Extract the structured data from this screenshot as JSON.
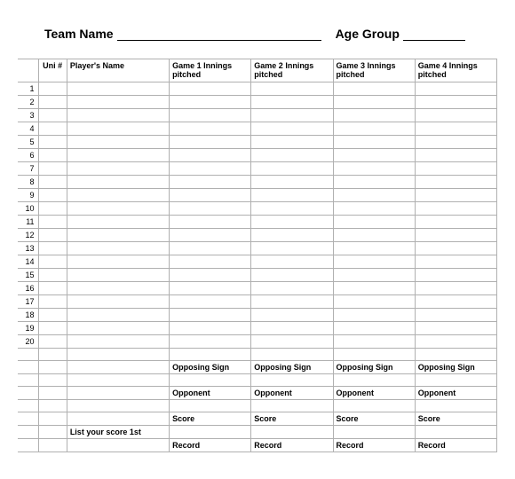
{
  "header": {
    "team_label": "Team Name",
    "age_label": "Age Group"
  },
  "columns": {
    "uni": "Uni #",
    "player": "Player's Name",
    "game1": "Game 1 Innings pitched",
    "game2": "Game 2 Innings pitched",
    "game3": "Game 3 Innings pitched",
    "game4": "Game 4 Innings pitched"
  },
  "rows": [
    "1",
    "2",
    "3",
    "4",
    "5",
    "6",
    "7",
    "8",
    "9",
    "10",
    "11",
    "12",
    "13",
    "14",
    "15",
    "16",
    "17",
    "18",
    "19",
    "20"
  ],
  "footer": {
    "opposing_sign": "Opposing Sign",
    "opponent": "Opponent",
    "score": "Score",
    "record": "Record",
    "list_score_first": "List your score 1st"
  }
}
